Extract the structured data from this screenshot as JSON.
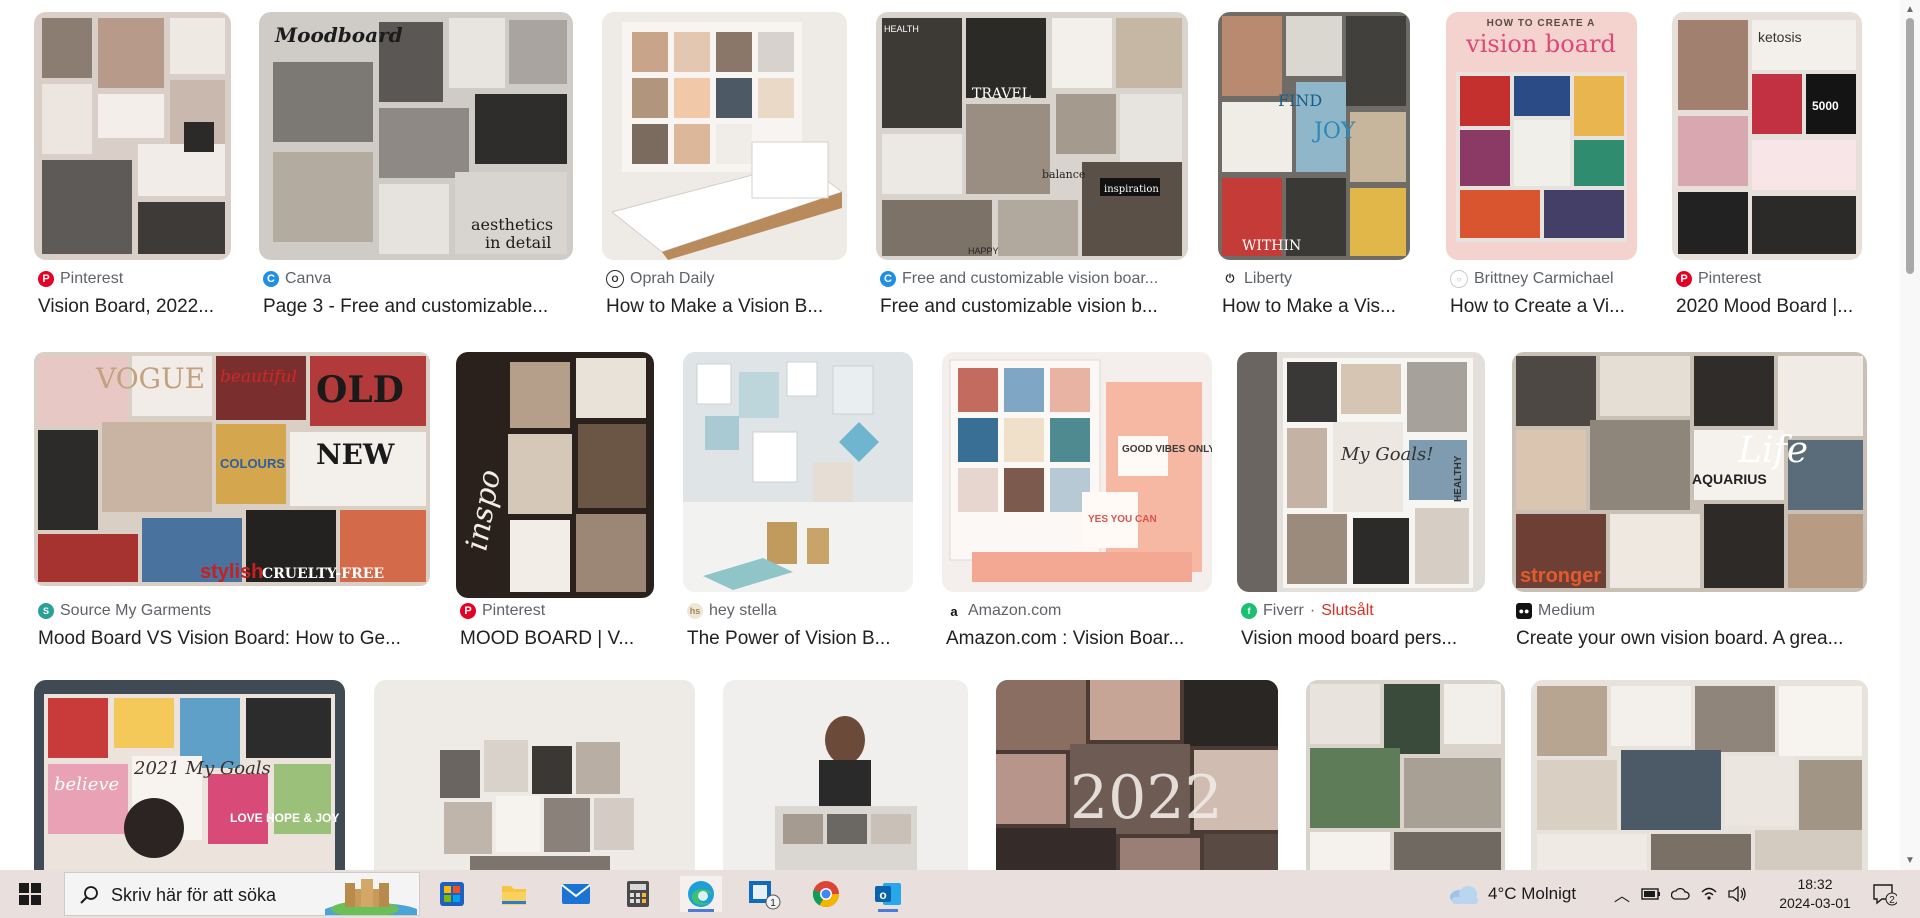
{
  "results": [
    {
      "source": "Pinterest",
      "title": "Vision Board, 2022...",
      "favicon": "pinterest-icon",
      "fav_color": "#e60023"
    },
    {
      "source": "Canva",
      "title": "Page 3 - Free and customizable...",
      "favicon": "canva-icon",
      "fav_color": "#1f8fe5"
    },
    {
      "source": "Oprah Daily",
      "title": "How to Make a Vision B...",
      "favicon": "oprah-icon",
      "fav_color": "#2b2b2b"
    },
    {
      "source": "Free and customizable vision boar...",
      "title": "Free and customizable vision b...",
      "favicon": "canva-icon",
      "fav_color": "#1f8fe5"
    },
    {
      "source": "Liberty",
      "title": "How to Make a Vis...",
      "favicon": "power-icon",
      "fav_color": "#222222"
    },
    {
      "source": "Brittney Carmichael",
      "title": "How to Create a Vi...",
      "favicon": "globe-icon",
      "fav_color": "#bbbbbb"
    },
    {
      "source": "Pinterest",
      "title": "2020 Mood Board |...",
      "favicon": "pinterest-icon",
      "fav_color": "#e60023"
    },
    {
      "source": "Source My Garments",
      "title": "Mood Board VS Vision Board: How to Ge...",
      "favicon": "garments-icon",
      "fav_color": "#2aa198"
    },
    {
      "source": "Pinterest",
      "title": "MOOD BOARD | V...",
      "favicon": "pinterest-icon",
      "fav_color": "#e60023"
    },
    {
      "source": "hey stella",
      "title": "The Power of Vision B...",
      "favicon": "stella-icon",
      "fav_color": "#c9b88f"
    },
    {
      "source": "Amazon.com",
      "title": "Amazon.com : Vision Boar...",
      "favicon": "amazon-icon",
      "fav_color": "#111111"
    },
    {
      "source": "Fiverr",
      "source_extra": "Slutsålt",
      "title": "Vision mood board pers...",
      "favicon": "fiverr-icon",
      "fav_color": "#1dbf73"
    },
    {
      "source": "Medium",
      "title": "Create your own vision board. A grea...",
      "favicon": "medium-icon",
      "fav_color": "#111111"
    }
  ],
  "thumbs_text": {
    "moodboard": "Moodboard",
    "aesthetics": "aesthetics",
    "in_detail": "in detail",
    "how_to_create": "HOW TO CREATE A",
    "vision_board": "vision board",
    "find": "FIND",
    "joy": "JOY",
    "within": "WITHIN",
    "travel": "TRAVEL",
    "health": "HEALTH",
    "balance": "balance",
    "inspiration": "inspiration",
    "happy": "HAPPY",
    "vogue": "VOGUE",
    "beautiful": "beautiful",
    "old": "OLD",
    "new": "NEW",
    "colours": "COLOURS",
    "stylish": "stylish",
    "cruelty": "CRUELTY-FREE",
    "inspo": "inspo",
    "good_vibes": "GOOD VIBES ONLY",
    "yes_you_can": "YES YOU CAN",
    "my_goals": "My Goals!",
    "healthy": "HEALTHY",
    "life": "Life",
    "aquarius": "AQUARIUS",
    "stronger": "stronger",
    "goals_2021": "2021 My Goals",
    "love_hope_joy": "LOVE HOPE & JOY",
    "believe": "believe",
    "year_2022": "2022",
    "ketosis": "ketosis",
    "n5000": "5000"
  },
  "taskbar": {
    "search_placeholder": "Skriv här för att söka",
    "weather": "4°C  Molnigt",
    "time": "18:32",
    "date": "2024-03-01",
    "outlook_badge": "1",
    "notification_count": "2"
  },
  "colors": {
    "taskbar_bg": "#e9e0dd",
    "accent": "#4c7bd9",
    "sold_out": "#d93025"
  }
}
